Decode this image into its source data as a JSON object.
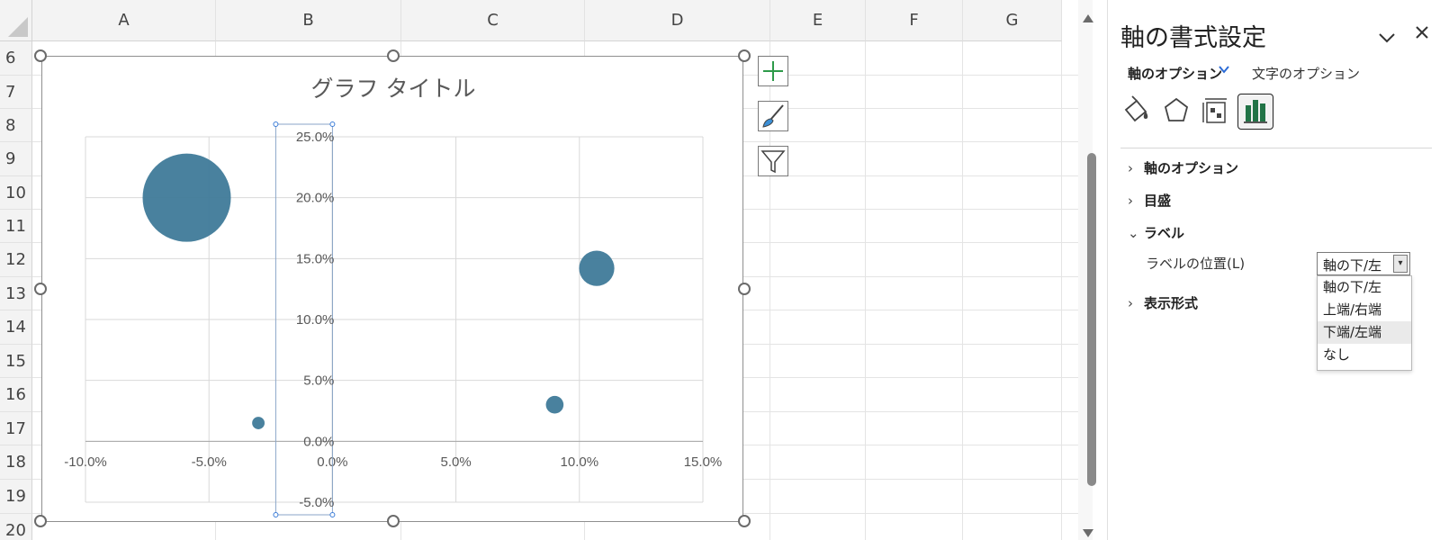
{
  "spreadsheet": {
    "columns": [
      "A",
      "B",
      "C",
      "D",
      "E",
      "F",
      "G"
    ],
    "rows": [
      "6",
      "7",
      "8",
      "9",
      "10",
      "11",
      "12",
      "13",
      "14",
      "15",
      "16",
      "17",
      "18",
      "19",
      "20"
    ]
  },
  "chart_data": {
    "type": "scatter",
    "variant": "bubble",
    "title": "グラフ タイトル",
    "xlim": [
      -0.1,
      0.15
    ],
    "ylim": [
      -0.05,
      0.25
    ],
    "x_tick_labels": [
      "-10.0%",
      "-5.0%",
      "0.0%",
      "5.0%",
      "10.0%",
      "15.0%"
    ],
    "y_tick_labels": [
      "-5.0%",
      "0.0%",
      "5.0%",
      "10.0%",
      "15.0%",
      "20.0%",
      "25.0%"
    ],
    "grid": true,
    "bubble_color": "#3f7a99",
    "points": [
      {
        "x": -0.059,
        "y": 0.2,
        "size": 1.0
      },
      {
        "x": -0.03,
        "y": 0.015,
        "size": 0.02
      },
      {
        "x": 0.09,
        "y": 0.03,
        "size": 0.04
      },
      {
        "x": 0.107,
        "y": 0.142,
        "size": 0.16
      }
    ]
  },
  "chart_buttons": [
    "plus-icon",
    "brush-icon",
    "filter-icon"
  ],
  "panel": {
    "title": "軸の書式設定",
    "tab_axis": "軸のオプション",
    "tab_text": "文字のオプション",
    "sections": {
      "axis_options": "軸のオプション",
      "tick_marks": "目盛",
      "labels": "ラベル",
      "number_format": "表示形式"
    },
    "label_position_label": "ラベルの位置(L)",
    "label_position_value": "軸の下/左",
    "label_position_options": [
      "軸の下/左",
      "上端/右端",
      "下端/左端",
      "なし"
    ],
    "highlighted_option_index": 2,
    "accent_color": "#2b6bd6",
    "active_icon_color": "#217346"
  }
}
